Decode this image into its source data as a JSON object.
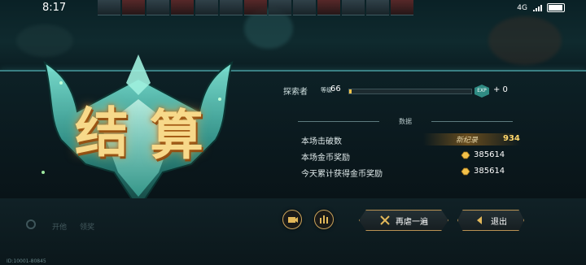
{
  "status_bar": {
    "time": "8:17",
    "signal": "4G"
  },
  "banner": {
    "title_char_1": "结",
    "title_char_2": "算"
  },
  "explorer": {
    "label": "探索者",
    "level_prefix": "等级",
    "level": "66",
    "exp_progress": 0.02,
    "exp_badge": "EXP",
    "exp_gain": "+ 0"
  },
  "data_section": {
    "title": "数据",
    "kills_label": "本场击破数",
    "record_label": "新纪录",
    "kills_value": "934",
    "gold_label": "本场金币奖励",
    "gold_value": "385614",
    "total_gold_label": "今天累计获得金币奖励",
    "total_gold_value": "385614"
  },
  "actions": {
    "replay_label": "再虐一遍",
    "exit_label": "退出"
  },
  "background": {
    "faded_text_1": "开他",
    "faded_text_2": "领奖"
  },
  "footer": {
    "id_text": "ID:10001-80845"
  },
  "colors": {
    "accent_teal": "#3a7f83",
    "gold": "#f7d98a",
    "record_gold": "#ffd76b"
  }
}
